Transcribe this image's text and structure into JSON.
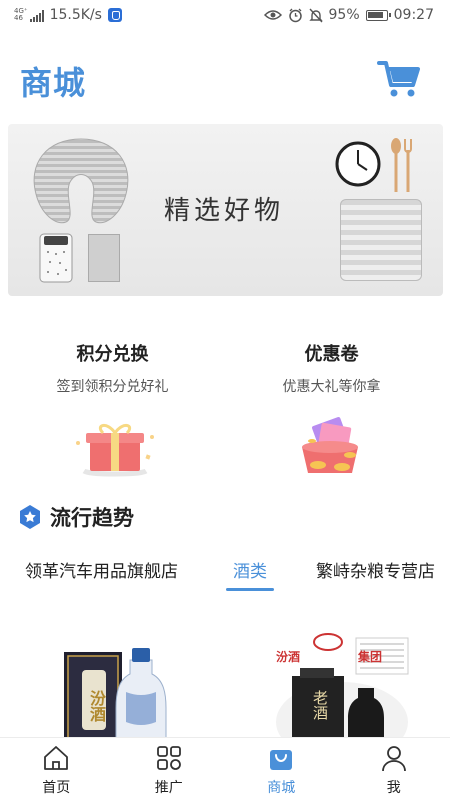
{
  "status_bar": {
    "network_type": "4G⁺",
    "network_sub": "46",
    "speed": "15.5K/s",
    "battery": "95%",
    "time": "09:27"
  },
  "header": {
    "title": "商城"
  },
  "banner": {
    "text": "精选好物"
  },
  "entries": [
    {
      "title": "积分兑换",
      "subtitle": "签到领积分兑好礼"
    },
    {
      "title": "优惠卷",
      "subtitle": "优惠大礼等你拿"
    }
  ],
  "section": {
    "title": "流行趋势"
  },
  "tabs": [
    {
      "label": "领革汽车用品旗舰店"
    },
    {
      "label": "酒类"
    },
    {
      "label": "繁峙杂粮专营店"
    }
  ],
  "active_tab": 1,
  "products": {
    "left_label": "汾酒",
    "right_header_left": "汾酒",
    "right_header_right": "集团",
    "right_bottle_label": "老酒"
  },
  "bottom_nav": [
    {
      "label": "首页"
    },
    {
      "label": "推广"
    },
    {
      "label": "商城"
    },
    {
      "label": "我"
    }
  ],
  "colors": {
    "accent": "#4a90d9",
    "text": "#222222"
  }
}
